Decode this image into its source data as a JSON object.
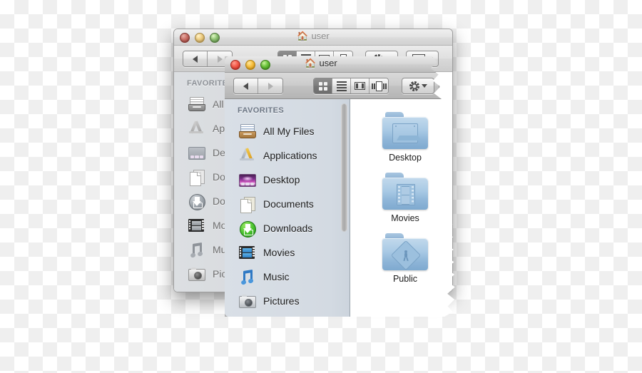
{
  "scene": {
    "description": "Two overlapping macOS Finder windows on transparent checkerboard background; front window has torn paper right edge",
    "background": "transparency-checkerboard"
  },
  "back_window": {
    "title": "user",
    "title_icon": "home-icon",
    "active": false,
    "traffic_lights": [
      {
        "name": "close-button",
        "color": "#f4594a"
      },
      {
        "name": "minimize-button",
        "color": "#f7bf3e"
      },
      {
        "name": "zoom-button",
        "color": "#68c33a"
      }
    ],
    "nav": {
      "back_label": "◀",
      "forward_label": "▶"
    },
    "view_modes": [
      {
        "name": "icon-view",
        "selected": true
      },
      {
        "name": "list-view",
        "selected": false
      },
      {
        "name": "column-view",
        "selected": false
      },
      {
        "name": "coverflow-view",
        "selected": false
      }
    ],
    "action_button": {
      "name": "action-gear-button",
      "icon": "gear-icon"
    },
    "arrange_button": {
      "name": "arrange-button",
      "icon": "grid-icon"
    },
    "sidebar": {
      "header": "FAVORITES",
      "items": [
        {
          "label": "All My Files",
          "icon": "all-my-files-icon"
        },
        {
          "label": "Applications",
          "icon": "applications-icon"
        },
        {
          "label": "Desktop",
          "icon": "desktop-icon"
        },
        {
          "label": "Documents",
          "icon": "documents-icon"
        },
        {
          "label": "Downloads",
          "icon": "downloads-icon"
        },
        {
          "label": "Movies",
          "icon": "movies-icon"
        },
        {
          "label": "Music",
          "icon": "music-icon"
        },
        {
          "label": "Pictures",
          "icon": "pictures-icon"
        }
      ]
    }
  },
  "front_window": {
    "title": "user",
    "title_icon": "home-icon",
    "active": true,
    "traffic_lights": [
      {
        "name": "close-button",
        "color": "#f4594a"
      },
      {
        "name": "minimize-button",
        "color": "#f7bf3e"
      },
      {
        "name": "zoom-button",
        "color": "#68c33a"
      }
    ],
    "nav": {
      "back_label": "◀",
      "forward_label": "▶"
    },
    "view_modes": [
      {
        "name": "icon-view",
        "selected": true
      },
      {
        "name": "list-view",
        "selected": false
      },
      {
        "name": "column-view",
        "selected": false
      },
      {
        "name": "coverflow-view",
        "selected": false
      }
    ],
    "action_button": {
      "name": "action-gear-button",
      "icon": "gear-icon"
    },
    "arrange_button": {
      "name": "arrange-button",
      "icon": "grid-icon"
    },
    "sidebar": {
      "header": "FAVORITES",
      "items": [
        {
          "label": "All My Files",
          "icon": "all-my-files-icon"
        },
        {
          "label": "Applications",
          "icon": "applications-icon"
        },
        {
          "label": "Desktop",
          "icon": "desktop-icon"
        },
        {
          "label": "Documents",
          "icon": "documents-icon"
        },
        {
          "label": "Downloads",
          "icon": "downloads-icon"
        },
        {
          "label": "Movies",
          "icon": "movies-icon"
        },
        {
          "label": "Music",
          "icon": "music-icon"
        },
        {
          "label": "Pictures",
          "icon": "pictures-icon"
        }
      ]
    },
    "content": {
      "view": "icon",
      "folders": [
        {
          "name": "Desktop",
          "icon": "folder-desktop-icon"
        },
        {
          "name": "Movies",
          "icon": "folder-movies-icon"
        },
        {
          "name": "Public",
          "icon": "folder-public-icon"
        }
      ]
    }
  },
  "colors": {
    "sidebar_bg": "#d5dce4",
    "folder_blue": "#a8c9e4",
    "toolbar_gray": "#cbcbcb",
    "content_bg": "#ffffff"
  }
}
